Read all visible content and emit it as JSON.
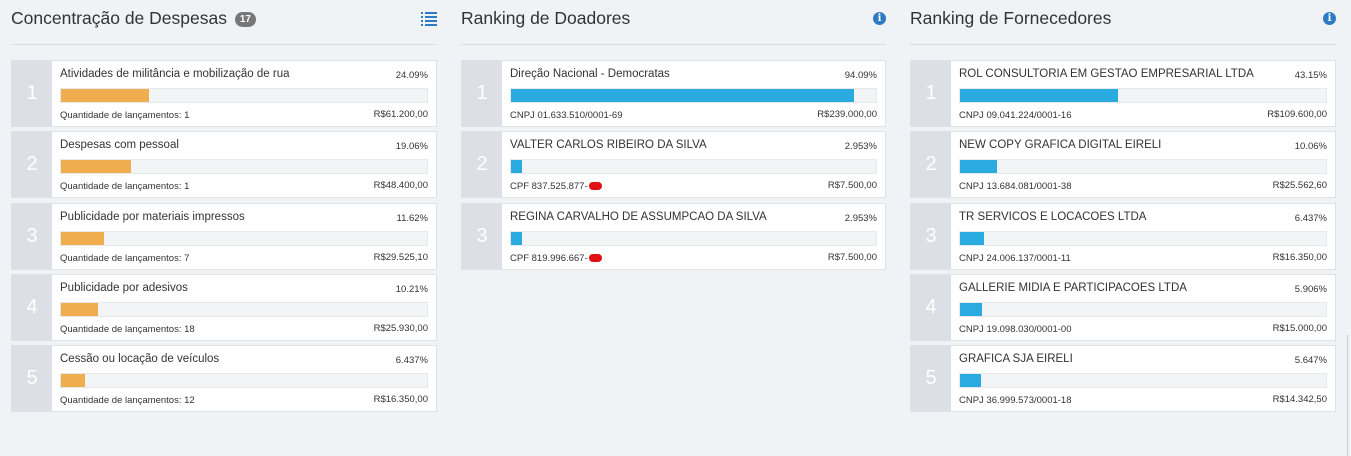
{
  "colors": {
    "expense_bar": "#f0ad4e",
    "ranking_bar": "#29abe0",
    "icon": "#2d7bc0"
  },
  "despesas": {
    "title": "Concentração de Despesas",
    "badge": "17",
    "header_icon": "list-icon",
    "items": [
      {
        "rank": "1",
        "name": "Atividades de militância e mobilização de rua",
        "pct": "24.09%",
        "fill": 0.2409,
        "sub": "Quantidade de lançamentos: 1",
        "amount": "R$61.200,00"
      },
      {
        "rank": "2",
        "name": "Despesas com pessoal",
        "pct": "19.06%",
        "fill": 0.1906,
        "sub": "Quantidade de lançamentos: 1",
        "amount": "R$48.400,00"
      },
      {
        "rank": "3",
        "name": "Publicidade por materiais impressos",
        "pct": "11.62%",
        "fill": 0.1162,
        "sub": "Quantidade de lançamentos: 7",
        "amount": "R$29.525,10"
      },
      {
        "rank": "4",
        "name": "Publicidade por adesivos",
        "pct": "10.21%",
        "fill": 0.1021,
        "sub": "Quantidade de lançamentos: 18",
        "amount": "R$25.930,00"
      },
      {
        "rank": "5",
        "name": "Cessão ou locação de veículos",
        "pct": "6.437%",
        "fill": 0.06437,
        "sub": "Quantidade de lançamentos: 12",
        "amount": "R$16.350,00"
      }
    ]
  },
  "doadores": {
    "title": "Ranking de Doadores",
    "header_icon": "info-icon",
    "items": [
      {
        "rank": "1",
        "name": "Direção Nacional - Democratas",
        "pct": "94.09%",
        "fill": 0.9409,
        "sub": "CNPJ 01.633.510/0001-69",
        "redacted": false,
        "amount": "R$239.000,00"
      },
      {
        "rank": "2",
        "name": "VALTER CARLOS RIBEIRO DA SILVA",
        "pct": "2.953%",
        "fill": 0.02953,
        "sub": "CPF 837.525.877-",
        "redacted": true,
        "amount": "R$7.500,00"
      },
      {
        "rank": "3",
        "name": "REGINA CARVALHO DE ASSUMPCAO DA SILVA",
        "pct": "2.953%",
        "fill": 0.02953,
        "sub": "CPF 819.996.667-",
        "redacted": true,
        "amount": "R$7.500,00"
      }
    ]
  },
  "fornecedores": {
    "title": "Ranking de Fornecedores",
    "header_icon": "info-icon",
    "items": [
      {
        "rank": "1",
        "name": "ROL CONSULTORIA EM GESTAO EMPRESARIAL LTDA",
        "pct": "43.15%",
        "fill": 0.4315,
        "sub": "CNPJ 09.041.224/0001-16",
        "amount": "R$109.600,00"
      },
      {
        "rank": "2",
        "name": "NEW COPY GRAFICA DIGITAL EIRELI",
        "pct": "10.06%",
        "fill": 0.1006,
        "sub": "CNPJ 13.684.081/0001-38",
        "amount": "R$25.562,60"
      },
      {
        "rank": "3",
        "name": "TR SERVICOS E LOCACOES LTDA",
        "pct": "6.437%",
        "fill": 0.06437,
        "sub": "CNPJ 24.006.137/0001-11",
        "amount": "R$16.350,00"
      },
      {
        "rank": "4",
        "name": "GALLERIE MIDIA E PARTICIPACOES LTDA",
        "pct": "5.906%",
        "fill": 0.05906,
        "sub": "CNPJ 19.098.030/0001-00",
        "amount": "R$15.000,00"
      },
      {
        "rank": "5",
        "name": "GRAFICA SJA EIRELI",
        "pct": "5.647%",
        "fill": 0.05647,
        "sub": "CNPJ 36.999.573/0001-18",
        "amount": "R$14.342,50"
      }
    ]
  }
}
